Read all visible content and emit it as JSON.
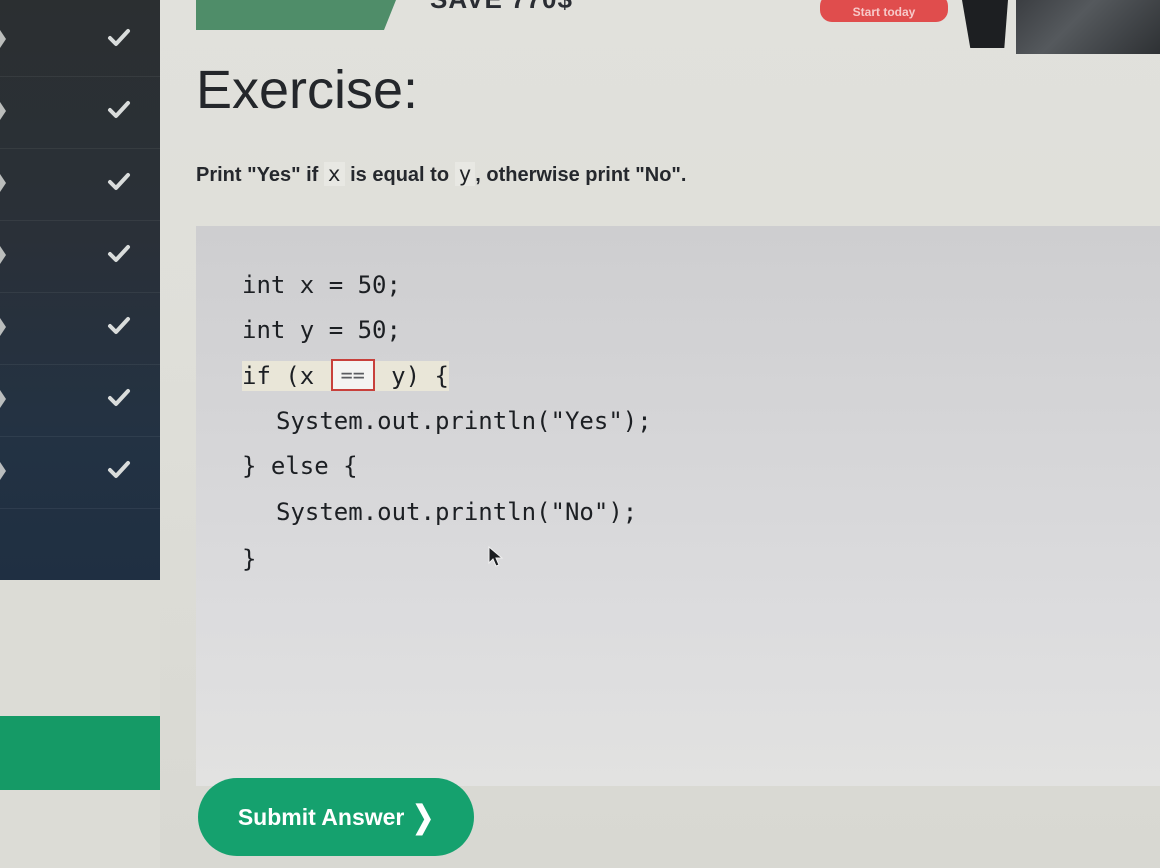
{
  "banner": {
    "promo_text": "SAVE 770$",
    "cta_label": "Start today"
  },
  "sidebar": {
    "completed_items": [
      {
        "icon": "check-icon",
        "status": "completed"
      },
      {
        "icon": "check-icon",
        "status": "completed"
      },
      {
        "icon": "check-icon",
        "status": "completed"
      },
      {
        "icon": "check-icon",
        "status": "completed"
      },
      {
        "icon": "check-icon",
        "status": "completed"
      },
      {
        "icon": "check-icon",
        "status": "completed"
      },
      {
        "icon": "check-icon",
        "status": "completed"
      },
      {
        "icon": "check-icon",
        "status": "completed"
      }
    ]
  },
  "exercise": {
    "title": "Exercise:",
    "instruction_prefix": "Print \"Yes\" if",
    "var_x": "x",
    "instruction_middle": "is equal to",
    "var_y": "y",
    "instruction_suffix": ", otherwise print \"No\"."
  },
  "code": {
    "line1": "int x = 50;",
    "line2": "int y = 50;",
    "line3_before": "if (x ",
    "line3_blank_value": "==",
    "line3_after": " y) {",
    "line4": "System.out.println(\"Yes\");",
    "line5": "} else {",
    "line6": "System.out.println(\"No\");",
    "line7": "}"
  },
  "submit": {
    "label": "Submit Answer",
    "chevron": "❯"
  },
  "colors": {
    "accent_green": "#15a16e",
    "sidebar_dark": "#233243",
    "cta_red": "#e04d4d",
    "blank_border": "#c8403b"
  }
}
